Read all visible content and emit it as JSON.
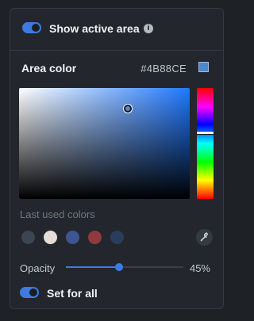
{
  "show_active_area": {
    "label": "Show active area",
    "enabled": true
  },
  "area_color": {
    "label": "Area color",
    "hex": "#4B88CE"
  },
  "last_used": {
    "label": "Last used colors",
    "colors": [
      "#3d4550",
      "#e5ddd6",
      "#3e5593",
      "#8e3a3f",
      "#2b3d5d"
    ]
  },
  "opacity": {
    "label": "Opacity",
    "value_text": "45%",
    "value": 0.45
  },
  "set_for_all": {
    "label": "Set for all",
    "enabled": true
  },
  "colors": {
    "accent": "#3d7be0",
    "hue_base": "#1f78ff"
  },
  "icons": {
    "info": "info-icon",
    "eyedropper": "eyedropper-icon"
  }
}
